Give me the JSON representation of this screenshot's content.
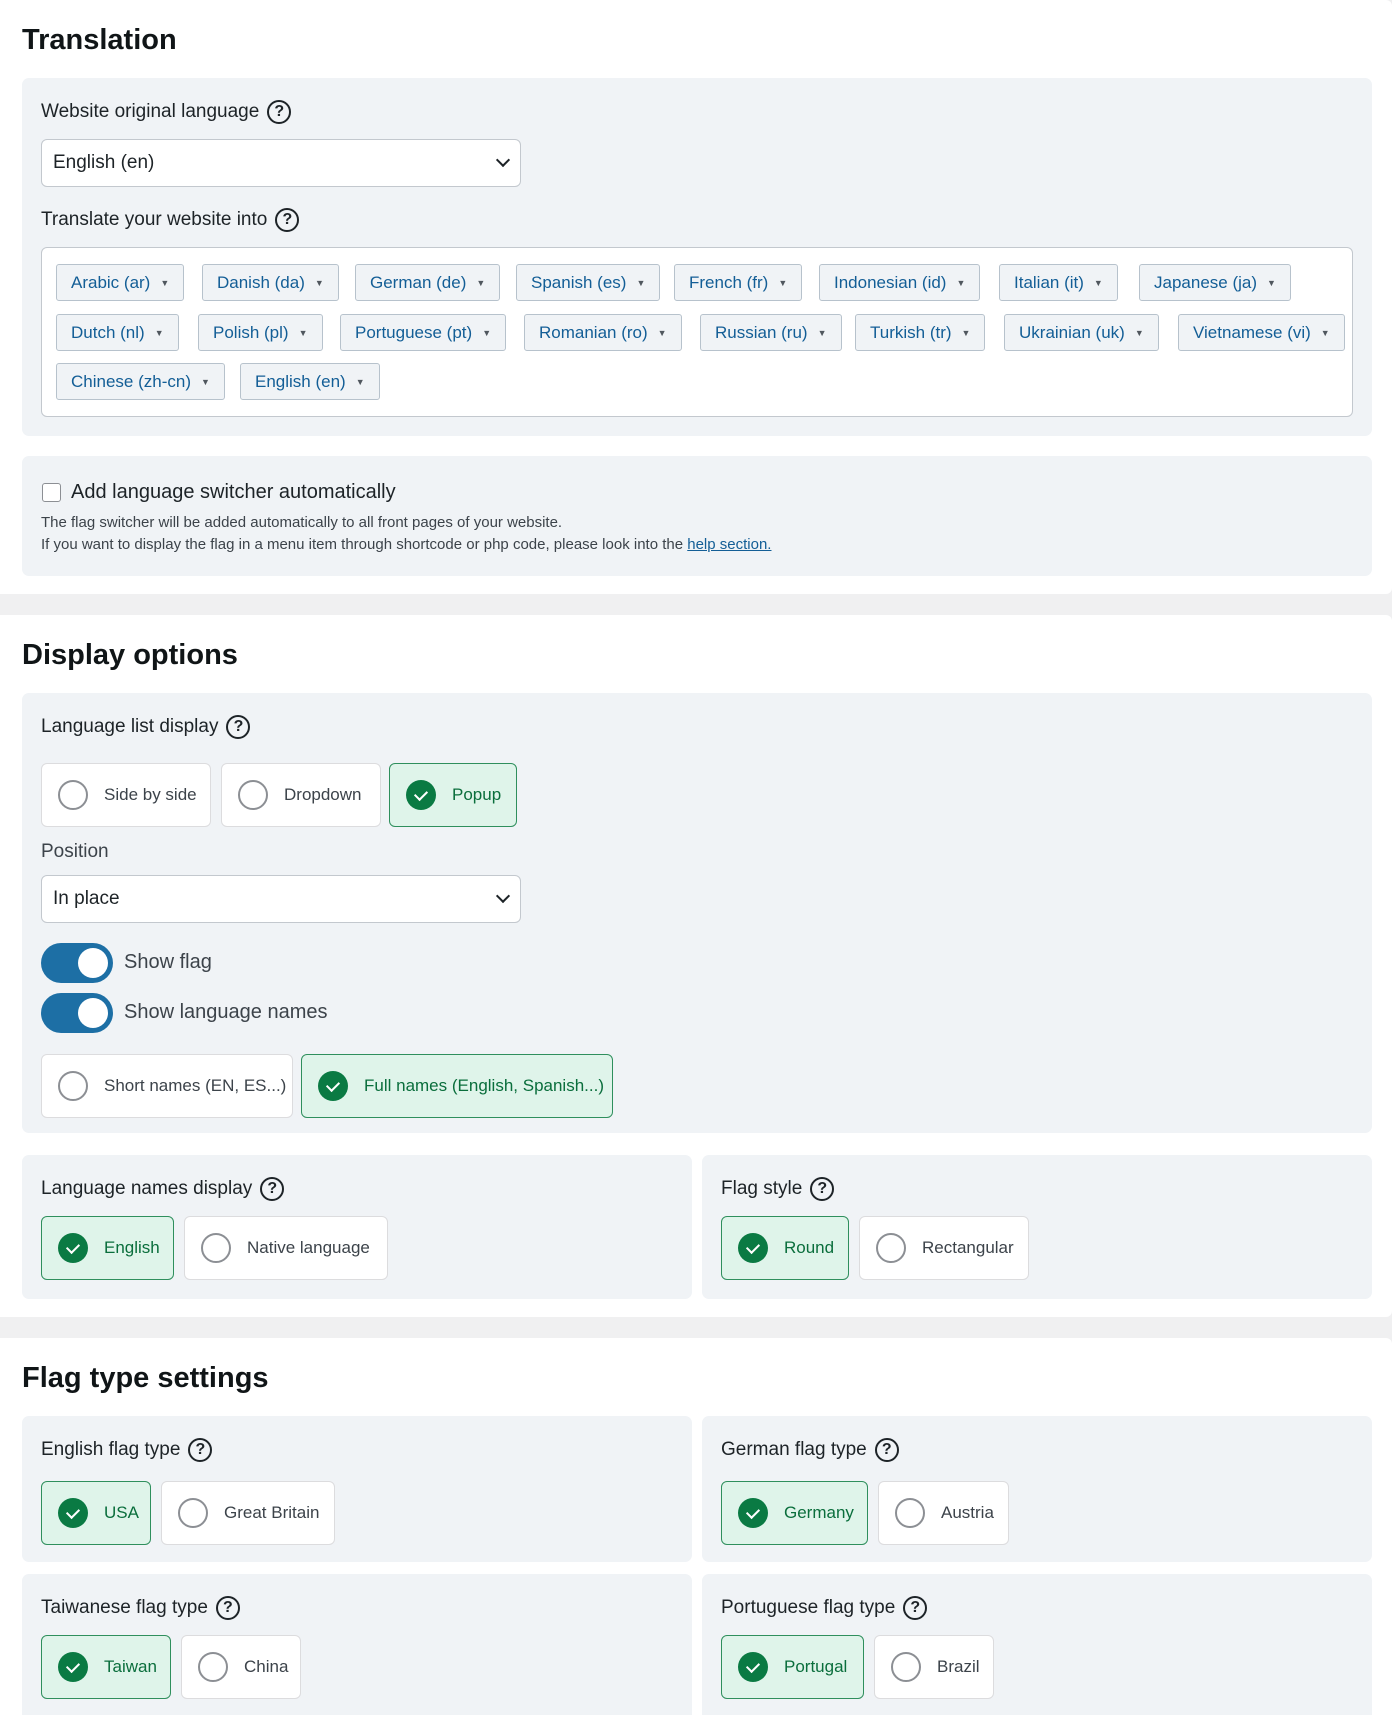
{
  "translation": {
    "title": "Translation",
    "original_language_label": "Website original language",
    "original_language_value": "English (en)",
    "translate_into_label": "Translate your website into",
    "languages": [
      "Arabic (ar)",
      "Danish (da)",
      "German (de)",
      "Spanish (es)",
      "French (fr)",
      "Indonesian (id)",
      "Italian (it)",
      "Japanese (ja)",
      "Dutch (nl)",
      "Polish (pl)",
      "Portuguese (pt)",
      "Romanian (ro)",
      "Russian (ru)",
      "Turkish (tr)",
      "Ukrainian (uk)",
      "Vietnamese (vi)",
      "Chinese (zh-cn)",
      "English (en)"
    ],
    "switcher_label": "Add language switcher automatically",
    "switcher_checked": false,
    "switcher_desc_1": "The flag switcher will be added automatically to all front pages of your website.",
    "switcher_desc_2": "If you want to display the flag in a menu item through shortcode or php code, please look into the",
    "help_link": "help section."
  },
  "display": {
    "title": "Display options",
    "list_display_label": "Language list display",
    "list_options": [
      "Side by side",
      "Dropdown",
      "Popup"
    ],
    "list_selected": "Popup",
    "position_label": "Position",
    "position_value": "In place",
    "show_flag_label": "Show flag",
    "show_flag_on": true,
    "show_names_label": "Show language names",
    "show_names_on": true,
    "name_length_options": [
      "Short names (EN, ES...)",
      "Full names (English, Spanish...)"
    ],
    "name_length_selected": "Full names (English, Spanish...)",
    "names_display_label": "Language names display",
    "names_display_options": [
      "English",
      "Native language"
    ],
    "names_display_selected": "English",
    "flag_style_label": "Flag style",
    "flag_style_options": [
      "Round",
      "Rectangular"
    ],
    "flag_style_selected": "Round"
  },
  "flag_types": {
    "title": "Flag type settings",
    "english_label": "English flag type",
    "english_options": [
      "USA",
      "Great Britain"
    ],
    "english_selected": "USA",
    "german_label": "German flag type",
    "german_options": [
      "Germany",
      "Austria"
    ],
    "german_selected": "Germany",
    "taiwanese_label": "Taiwanese flag type",
    "taiwanese_options": [
      "Taiwan",
      "China"
    ],
    "taiwanese_selected": "Taiwan",
    "portuguese_label": "Portuguese flag type",
    "portuguese_options": [
      "Portugal",
      "Brazil"
    ],
    "portuguese_selected": "Portugal"
  },
  "icons": {
    "help": "question-circle-icon",
    "dropdown": "chevron-down-icon",
    "tag_caret": "caret-down-icon",
    "checkmark": "check-icon"
  },
  "colors": {
    "accent_blue": "#1d6fa5",
    "link_blue": "#135e96",
    "selected_green": "#0a7a43",
    "selected_bg": "#dff4ea",
    "panel_bg": "#f0f3f6"
  }
}
